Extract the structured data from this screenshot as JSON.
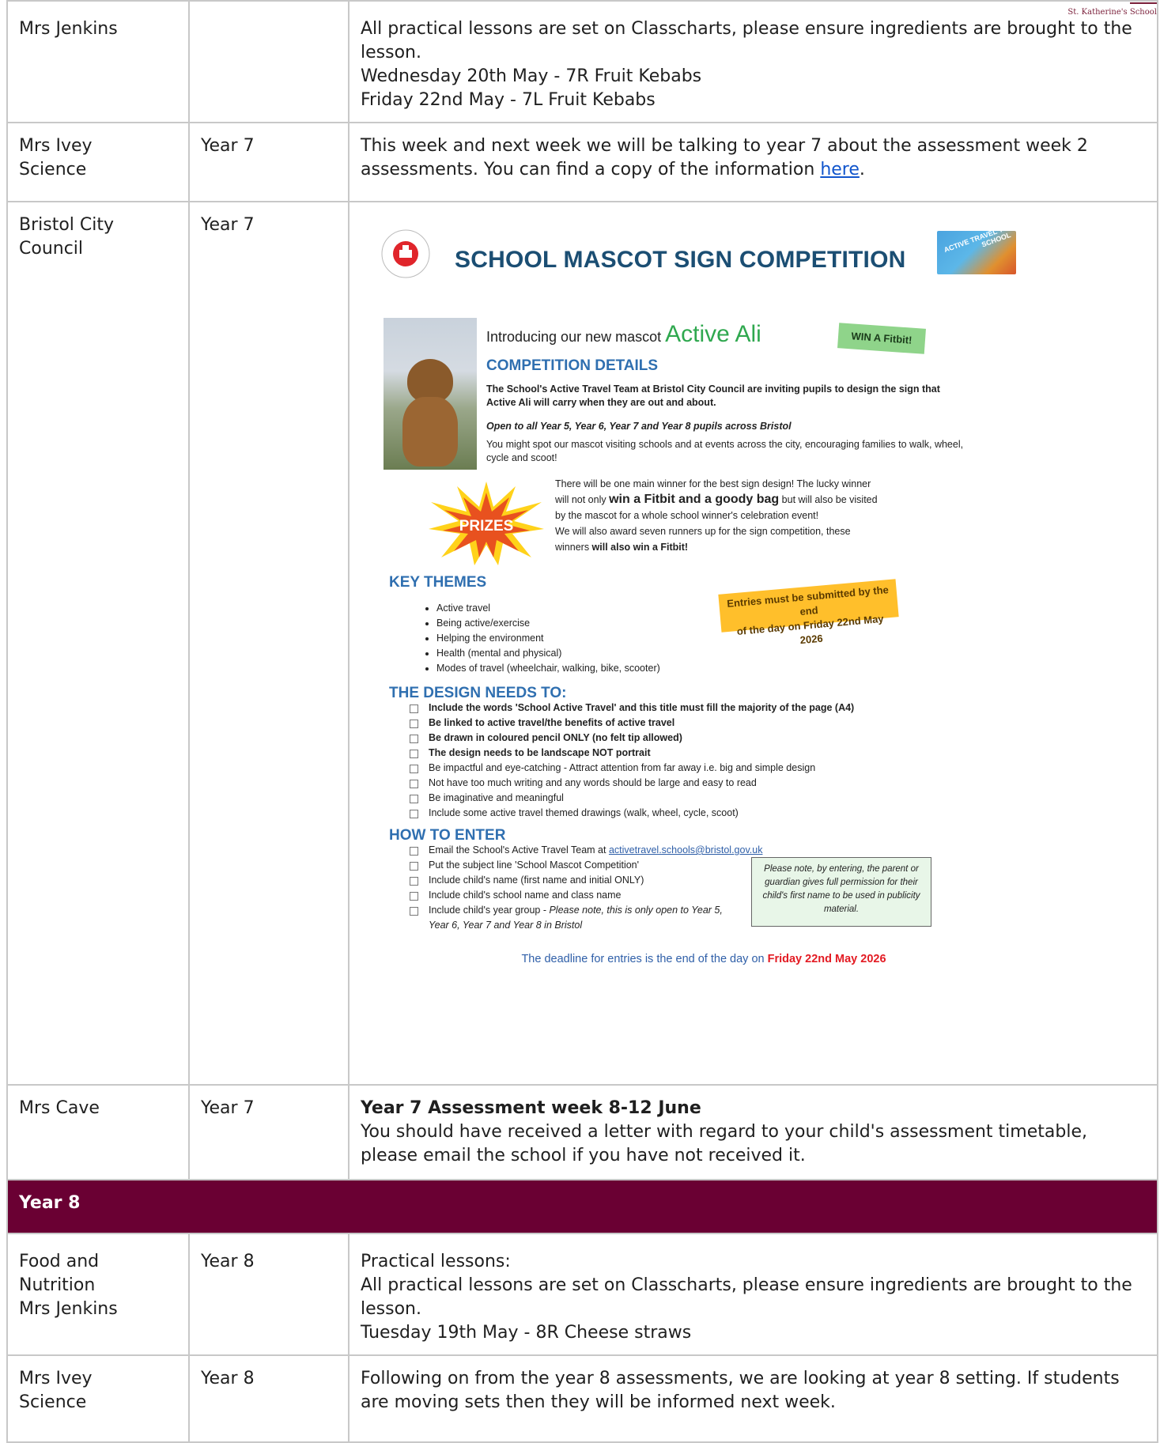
{
  "school": "St. Katherine's School",
  "rows_top": [
    {
      "who": [
        "Mrs Jenkins"
      ],
      "year": "",
      "content": [
        "All practical lessons are set on Classcharts, please ensure ingredients are brought to the lesson.",
        "Wednesday 20th May - 7R Fruit Kebabs",
        "Friday 22nd May - 7L Fruit Kebabs"
      ]
    }
  ],
  "row_ivey7": {
    "who": [
      "Mrs Ivey",
      "Science"
    ],
    "year": "Year 7",
    "text": "This week and next week we will be talking to year 7 about the assessment week 2 assessments. You can find a copy of the information ",
    "link": "here",
    "after": "."
  },
  "row_bristol": {
    "who": [
      "Bristol City",
      "Council"
    ],
    "year": "Year 7"
  },
  "poster": {
    "logo_text": "BRISTOL CITY COUNCIL",
    "title": "SCHOOL MASCOT SIGN COMPETITION",
    "badge": "ACTIVE TRAVEL TO SCHOOL",
    "intro": "Introducing our new mascot ",
    "mascot": "Active Ali",
    "win": "WIN A Fitbit!",
    "comp_heading": "COMPETITION DETAILS",
    "comp_p1": "The School's Active Travel Team at Bristol City Council are inviting pupils to design the sign that Active Ali will carry when they are out and about.",
    "comp_p2": "Open to all Year 5, Year 6, Year 7 and Year 8 pupils across Bristol",
    "comp_p3": "You might spot our mascot visiting schools and at events across the city, encouraging families to walk, wheel, cycle and scoot!",
    "prizes_label": "PRIZES",
    "prize_1": "There will be one main winner for the best sign design! The lucky winner",
    "prize_2a": "will not only ",
    "prize_2b": "win a Fitbit and a goody bag",
    "prize_2c": " but will also be visited",
    "prize_3": "by the mascot for a whole school winner's celebration event!",
    "prize_4": "We will also award seven runners up for the sign competition, these",
    "prize_5a": "winners ",
    "prize_5b": "will also win a Fitbit!",
    "kt_heading": "KEY THEMES",
    "key_themes": [
      "Active travel",
      "Being active/exercise",
      "Helping the environment",
      "Health (mental and physical)",
      "Modes of travel (wheelchair, walking, bike, scooter)"
    ],
    "entries_1": "Entries must be submitted by the end",
    "entries_2": "of the day on Friday 22nd May 2026",
    "dn_heading": "THE DESIGN NEEDS TO:",
    "design_needs": [
      {
        "t": "Include the words 'School Active Travel' and this title must fill the majority of the page (A4)",
        "b": true
      },
      {
        "t": "Be linked to active travel/the benefits of active travel",
        "b": true
      },
      {
        "t": "Be drawn in coloured pencil ONLY (no felt tip allowed)",
        "b": true
      },
      {
        "t": "The design needs to be landscape NOT portrait",
        "b": true
      },
      {
        "t": "Be impactful and eye-catching - Attract attention from far away i.e. big and simple design",
        "b": false
      },
      {
        "t": "Not have too much writing and any words should be large and easy to read",
        "b": false
      },
      {
        "t": "Be imaginative and meaningful",
        "b": false
      },
      {
        "t": "Include some active travel themed drawings (walk, wheel, cycle, scoot)",
        "b": false
      }
    ],
    "ht_heading": "HOW TO ENTER",
    "ht_1": "Email the School's Active Travel Team at ",
    "ht_email": "activetravel.schools@bristol.gov.uk",
    "ht_2": "Put the subject line 'School Mascot Competition'",
    "ht_3": "Include child's name (first name and initial ONLY)",
    "ht_4": "Include child's school name and class name",
    "ht_5": "Include child's year group - ",
    "ht_5i": "Please note, this is only open to Year 5, Year 6, Year 7 and Year 8 in Bristol",
    "note": "Please note, by entering, the parent or guardian gives full permission for their child's first name to be used in publicity material.",
    "deadline_a": "The deadline for entries is the end of the day on ",
    "deadline_b": "Friday 22nd May 2026"
  },
  "row_cave": {
    "who": [
      "Mrs Cave"
    ],
    "year": "Year 7",
    "heading": "Year 7 Assessment week  8-12 June",
    "text": "You should have received a letter with regard to your child's assessment timetable, please email the school if you have not received it."
  },
  "section_year8": "Year 8",
  "row_food8": {
    "who": [
      "Food and",
      "Nutrition",
      "Mrs Jenkins"
    ],
    "year": "Year 8",
    "content": [
      "Practical lessons:",
      "All practical lessons are set on Classcharts, please ensure ingredients are brought to the lesson.",
      "Tuesday 19th May  - 8R Cheese straws"
    ]
  },
  "row_ivey8": {
    "who": [
      "Mrs Ivey",
      "Science"
    ],
    "year": "Year 8",
    "text": "Following on from the year 8 assessments, we are looking at year 8 setting. If students are moving sets then they will be informed next week."
  }
}
